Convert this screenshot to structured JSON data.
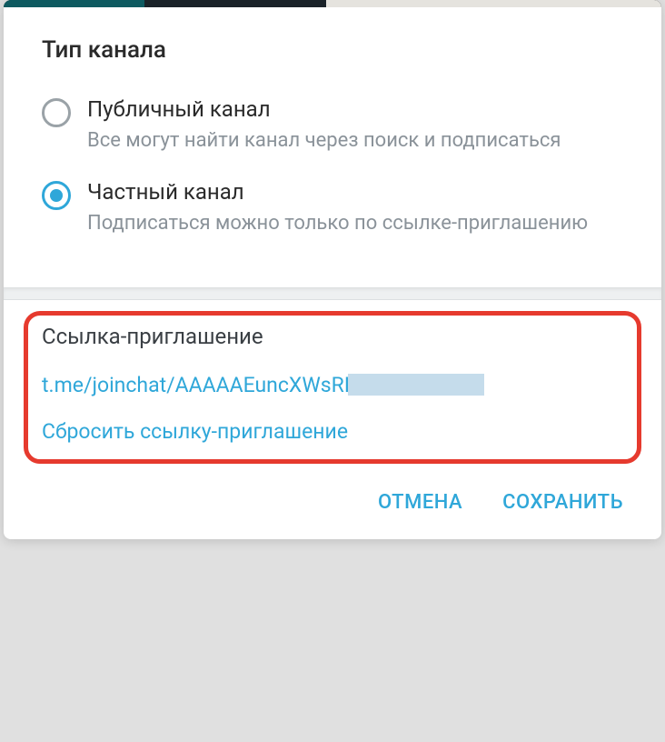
{
  "dialog": {
    "title": "Тип канала",
    "options": [
      {
        "label": "Публичный канал",
        "desc": "Все могут найти канал через поиск и подписаться",
        "selected": false
      },
      {
        "label": "Частный канал",
        "desc": "Подписаться можно только по ссылке-приглашению",
        "selected": true
      }
    ],
    "invite": {
      "title": "Ссылка-приглашение",
      "link": "t.me/joinchat/AAAAAEuncXWsRI",
      "reset": "Сбросить ссылку-приглашение"
    },
    "footer": {
      "cancel": "ОТМЕНА",
      "save": "СОХРАНИТЬ"
    }
  }
}
